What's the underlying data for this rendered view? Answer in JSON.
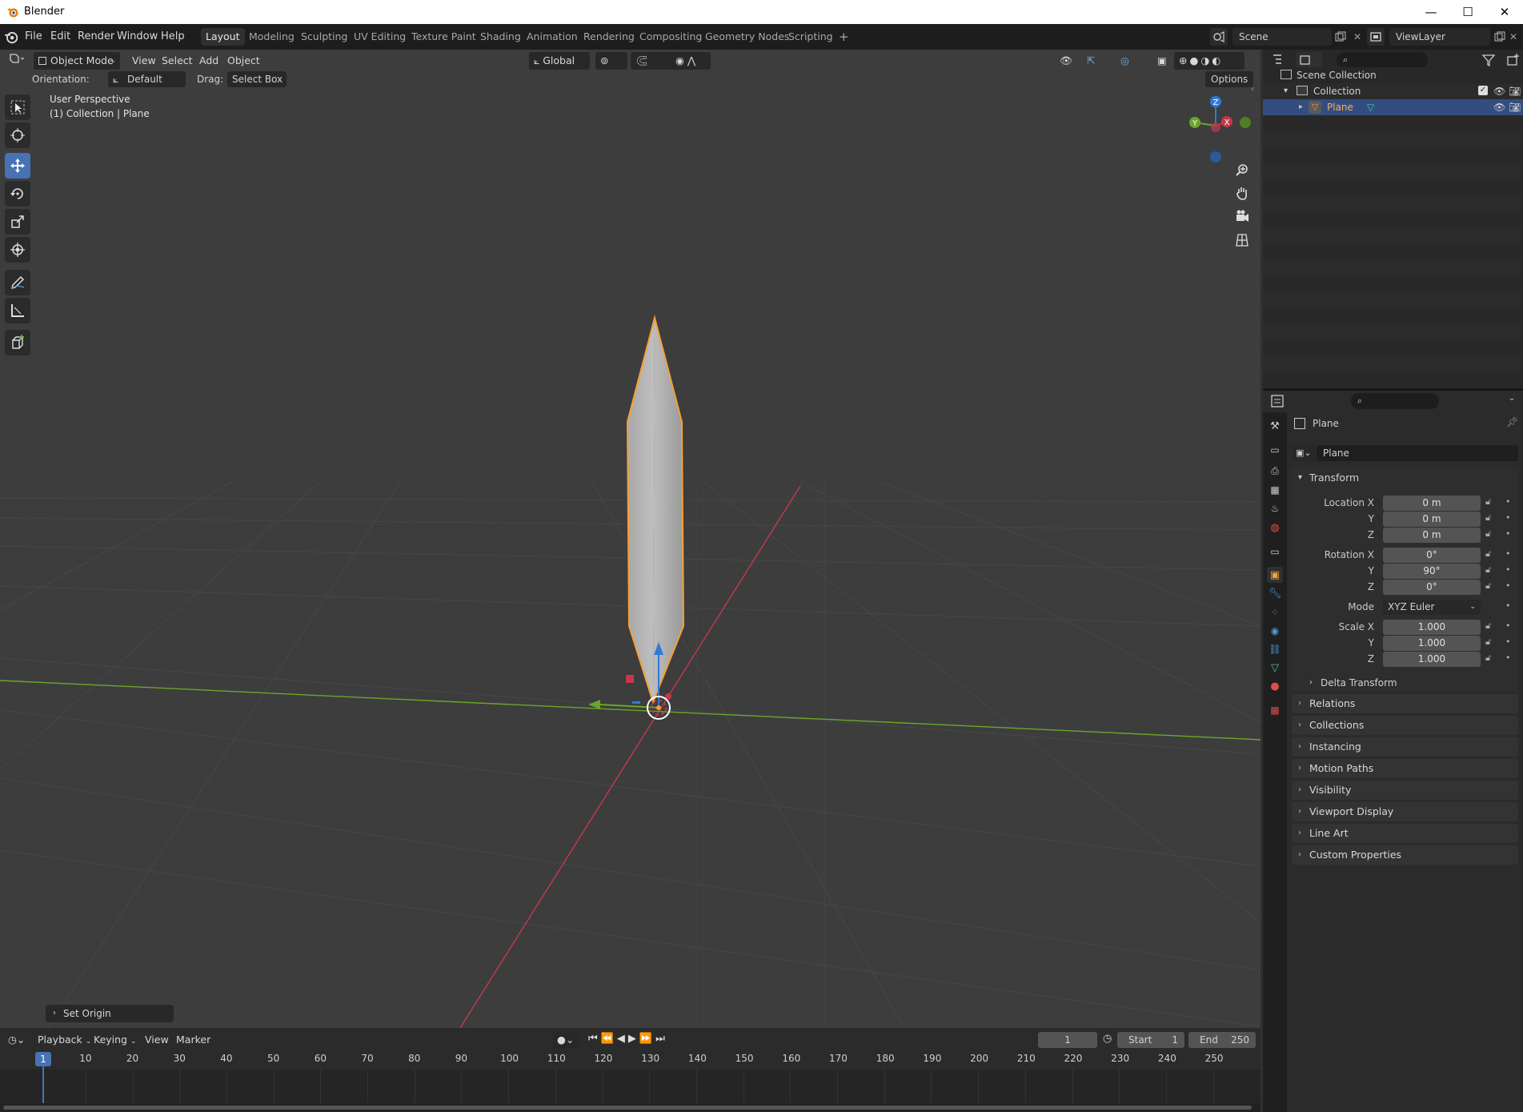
{
  "window": {
    "title": "Blender",
    "controls": [
      "—",
      "☐",
      "✕"
    ]
  },
  "menubar": {
    "menus": [
      "File",
      "Edit",
      "Render",
      "Window",
      "Help"
    ],
    "workspaces": [
      "Layout",
      "Modeling",
      "Sculpting",
      "UV Editing",
      "Texture Paint",
      "Shading",
      "Animation",
      "Rendering",
      "Compositing",
      "Geometry Nodes",
      "Scripting"
    ],
    "active_workspace": "Layout",
    "add_tab": "+",
    "scene": "Scene",
    "view_layer": "ViewLayer"
  },
  "viewport_header": {
    "mode": "Object Mode",
    "menus": [
      "View",
      "Select",
      "Add",
      "Object"
    ],
    "transform_orientation": "Global",
    "orientation_label": "Orientation:",
    "orientation_value": "Default",
    "drag_label": "Drag:",
    "drag_value": "Select Box",
    "options": "Options"
  },
  "viewport": {
    "perspective": "User Perspective",
    "context": "(1) Collection | Plane",
    "last_operator": "Set Origin",
    "gizmo_axes": [
      "Z",
      "Y",
      "X"
    ]
  },
  "outliner": {
    "rows": [
      {
        "label": "Scene Collection"
      },
      {
        "label": "Collection"
      },
      {
        "label": "Plane",
        "selected": true
      }
    ]
  },
  "properties": {
    "object_name": "Plane",
    "data_name": "Plane",
    "transform": {
      "header": "Transform",
      "location_label": "Location X",
      "rotation_label": "Rotation X",
      "scale_label": "Scale X",
      "y_label": "Y",
      "z_label": "Z",
      "location": [
        "0 m",
        "0 m",
        "0 m"
      ],
      "rotation": [
        "0°",
        "90°",
        "0°"
      ],
      "mode_label": "Mode",
      "mode": "XYZ Euler",
      "scale": [
        "1.000",
        "1.000",
        "1.000"
      ],
      "delta": "Delta Transform"
    },
    "panels": [
      "Relations",
      "Collections",
      "Instancing",
      "Motion Paths",
      "Visibility",
      "Viewport Display",
      "Line Art",
      "Custom Properties"
    ]
  },
  "timeline": {
    "menus": [
      "Playback",
      "Keying",
      "View",
      "Marker"
    ],
    "current_frame": "1",
    "start_label": "Start",
    "start": "1",
    "end_label": "End",
    "end": "250",
    "ruler": [
      "1",
      "10",
      "20",
      "30",
      "40",
      "50",
      "60",
      "70",
      "80",
      "90",
      "100",
      "110",
      "120",
      "130",
      "140",
      "150",
      "160",
      "170",
      "180",
      "190",
      "200",
      "210",
      "220",
      "230",
      "240",
      "250"
    ]
  },
  "colors": {
    "accent": "#4772b3",
    "selection_outline": "#f5a035",
    "x_axis": "#c4384a",
    "y_axis": "#6aa62b",
    "z_axis": "#2f7bd6"
  }
}
